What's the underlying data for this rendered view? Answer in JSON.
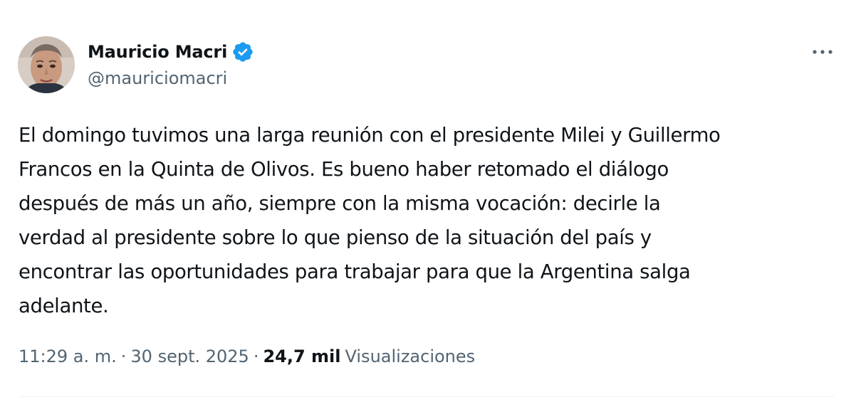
{
  "author": {
    "display_name": "Mauricio Macri",
    "handle": "@mauriciomacri",
    "verified": true,
    "avatar_icon": "profile-photo"
  },
  "tweet": {
    "lines": [
      "El domingo tuvimos una larga reunión con el presidente Milei y Guillermo",
      "Francos en la Quinta de Olivos. Es bueno haber retomado el diálogo",
      "después de más un año, siempre con la misma vocación: decirle la",
      "verdad al presidente sobre lo que pienso de la situación del país y",
      "encontrar las oportunidades para trabajar para que la Argentina salga",
      "adelante."
    ],
    "time": "11:29 a. m.",
    "date": "30 sept. 2025",
    "separator": "·",
    "views_count": "24,7 mil",
    "views_label": "Visualizaciones"
  },
  "actions": {
    "more_icon": "more-horizontal-icon"
  },
  "colors": {
    "text_primary": "#0f1419",
    "text_secondary": "#536471",
    "verified_blue": "#1d9bf0",
    "divider": "#eff3f4"
  }
}
